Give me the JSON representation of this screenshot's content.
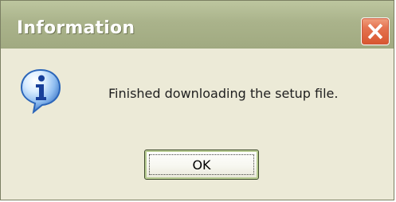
{
  "window": {
    "title": "Information",
    "close_icon": "close-icon"
  },
  "message": {
    "icon": "info-icon",
    "text": "Finished downloading the setup file."
  },
  "actions": {
    "ok_label": "OK"
  },
  "colors": {
    "titlebar": "#aab38b",
    "dialog_background": "#ecead7",
    "close_button": "#e57452",
    "ok_focus_border": "#b8cc92"
  }
}
